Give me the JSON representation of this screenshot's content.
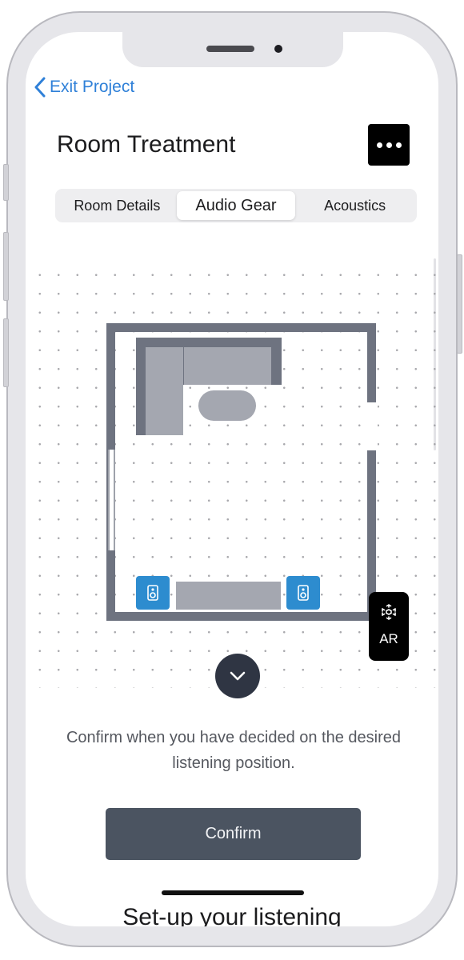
{
  "nav": {
    "back_label": "Exit Project",
    "back_icon": "chevron-left-icon",
    "accent_color": "#2f80d8"
  },
  "header": {
    "title": "Room Treatment",
    "more_icon": "more-horizontal-icon"
  },
  "tabs": [
    {
      "label": "Room Details",
      "active": false
    },
    {
      "label": "Audio Gear",
      "active": true
    },
    {
      "label": "Acoustics",
      "active": false
    }
  ],
  "floorplan": {
    "speaker_icon": "speaker-icon",
    "speaker_color": "#2d8ccf",
    "wall_color": "#6e7380",
    "furniture_color": "#a4a7b0",
    "grid": true
  },
  "ar_button": {
    "label": "AR",
    "icon": "ar-cube-icon"
  },
  "expand_icon": "chevron-down-icon",
  "instruction": "Confirm when you have decided on the desired listening position.",
  "confirm_label": "Confirm",
  "next_section_heading": "Set-up your listening"
}
